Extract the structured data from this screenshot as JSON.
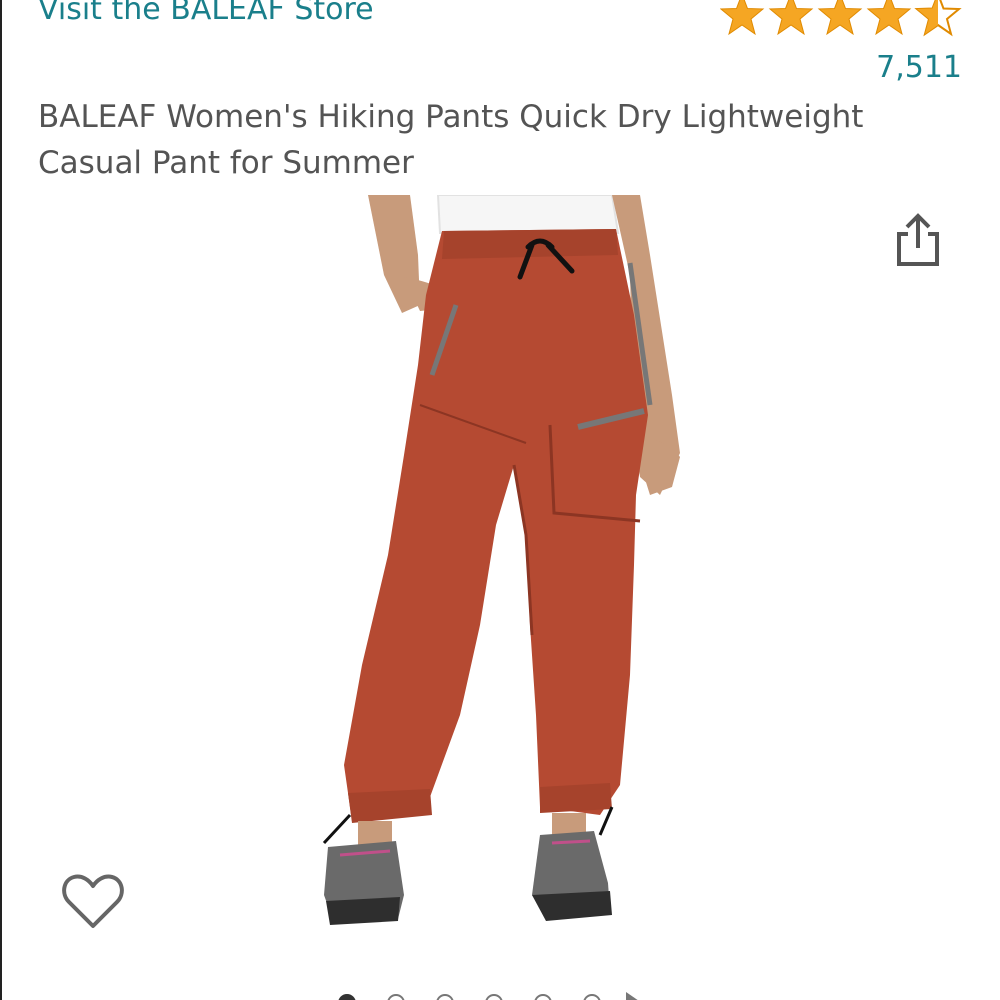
{
  "store": {
    "link_text": "Visit the BALEAF Store"
  },
  "rating": {
    "stars": 4.5,
    "max_stars": 5,
    "count": "7,511",
    "star_color": "#f5a623"
  },
  "product": {
    "title": "BALEAF Women's Hiking Pants Quick Dry Lightweight Casual Pant for Summer",
    "pants_color": "#b54a32"
  },
  "icons": {
    "share": "share-icon",
    "wishlist": "heart-outline-icon",
    "carousel_next": "play-icon"
  },
  "carousel": {
    "total_images": 6,
    "active_index": 0
  },
  "colors": {
    "link": "#1a7f8b",
    "text": "#545454"
  }
}
